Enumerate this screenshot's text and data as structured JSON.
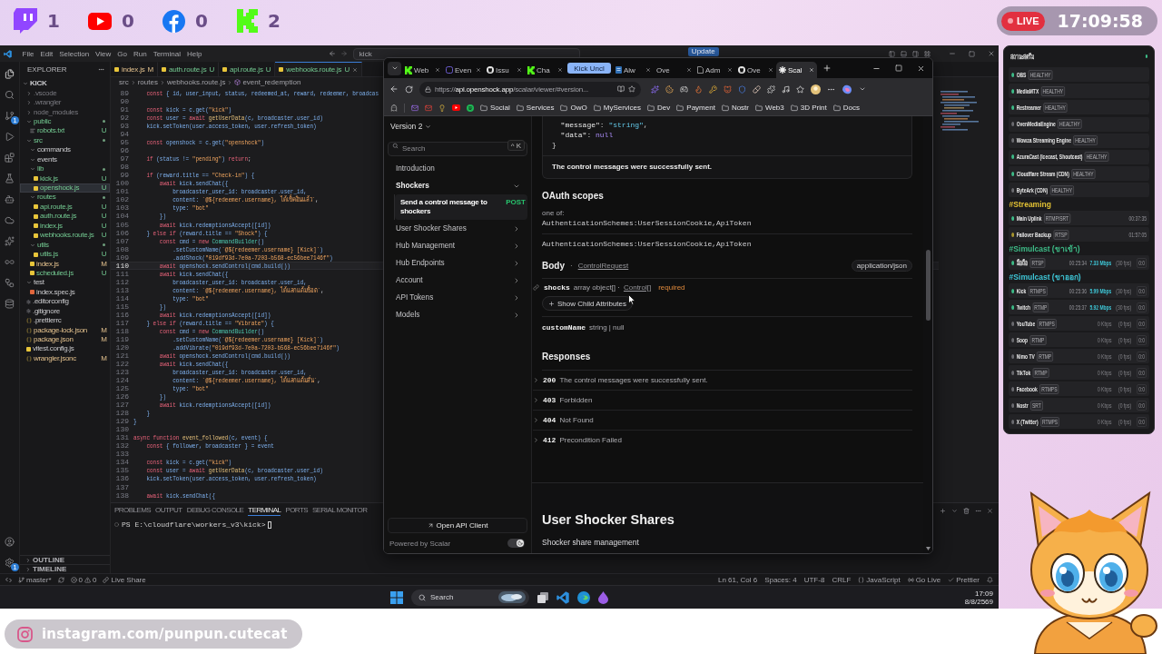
{
  "overlay": {
    "socials": [
      {
        "kind": "bubble",
        "count": "1"
      },
      {
        "kind": "play",
        "count": "0"
      },
      {
        "kind": "f-circle",
        "count": "0"
      },
      {
        "kind": "k-block",
        "count": "2"
      }
    ],
    "live": "LIVE",
    "clock": "17:09:58",
    "instagram": "instagram.com/punpun.cutecat"
  },
  "vscode": {
    "menu": [
      "File",
      "Edit",
      "Selection",
      "View",
      "Go",
      "Run",
      "Terminal",
      "Help"
    ],
    "command_center": "kick",
    "update": "Update",
    "scm_badge": "1",
    "settings_badge": "1",
    "explorer": {
      "title": "EXPLORER",
      "tree": [
        {
          "label": "KICK",
          "kind": "root",
          "expanded": true,
          "selected": false,
          "children": [
            {
              "label": ".vscode",
              "kind": "folder",
              "expanded": false,
              "ignored": true,
              "changed": false,
              "selected": false
            },
            {
              "label": ".wrangler",
              "kind": "folder",
              "expanded": false,
              "ignored": true,
              "changed": false,
              "selected": false
            },
            {
              "label": "node_modules",
              "kind": "folder",
              "expanded": false,
              "ignored": true,
              "changed": false,
              "selected": false
            },
            {
              "label": "public",
              "kind": "folder",
              "expanded": true,
              "ignored": false,
              "changed": true,
              "selected": false,
              "children": [
                {
                  "label": "robots.txt",
                  "kind": "text",
                  "status": "U",
                  "selected": false
                }
              ]
            },
            {
              "label": "src",
              "kind": "folder",
              "expanded": true,
              "ignored": false,
              "changed": true,
              "selected": false,
              "children": [
                {
                  "label": "commands",
                  "kind": "folder",
                  "expanded": true,
                  "ignored": false,
                  "changed": false,
                  "selected": false
                },
                {
                  "label": "events",
                  "kind": "folder",
                  "expanded": true,
                  "ignored": false,
                  "changed": false,
                  "selected": false
                },
                {
                  "label": "lib",
                  "kind": "folder",
                  "expanded": true,
                  "ignored": false,
                  "changed": true,
                  "selected": false,
                  "children": [
                    {
                      "label": "kick.js",
                      "kind": "js",
                      "status": "U",
                      "selected": false
                    },
                    {
                      "label": "openshock.js",
                      "kind": "js",
                      "status": "U",
                      "selected": true
                    }
                  ]
                },
                {
                  "label": "routes",
                  "kind": "folder",
                  "expanded": true,
                  "ignored": false,
                  "changed": true,
                  "selected": false,
                  "children": [
                    {
                      "label": "api.route.js",
                      "kind": "js",
                      "status": "U",
                      "selected": false
                    },
                    {
                      "label": "auth.route.js",
                      "kind": "js",
                      "status": "U",
                      "selected": false
                    },
                    {
                      "label": "index.js",
                      "kind": "js",
                      "status": "U",
                      "selected": false
                    },
                    {
                      "label": "webhooks.route.js",
                      "kind": "js",
                      "status": "U",
                      "selected": false
                    }
                  ]
                },
                {
                  "label": "utils",
                  "kind": "folder",
                  "expanded": true,
                  "ignored": false,
                  "changed": true,
                  "selected": false,
                  "children": [
                    {
                      "label": "utils.js",
                      "kind": "js",
                      "status": "U",
                      "selected": false
                    }
                  ]
                },
                {
                  "label": "index.js",
                  "kind": "js",
                  "status": "M",
                  "selected": false
                },
                {
                  "label": "scheduled.js",
                  "kind": "js",
                  "status": "U",
                  "selected": false
                }
              ]
            },
            {
              "label": "test",
              "kind": "folder",
              "expanded": true,
              "ignored": false,
              "changed": false,
              "selected": false,
              "children": [
                {
                  "label": "index.spec.js",
                  "kind": "test",
                  "selected": false
                }
              ]
            },
            {
              "label": ".editorconfig",
              "kind": "config",
              "selected": false
            },
            {
              "label": ".gitignore",
              "kind": "config",
              "selected": false
            },
            {
              "label": ".prettierrc",
              "kind": "json",
              "selected": false
            },
            {
              "label": "package-lock.json",
              "kind": "json",
              "status": "M",
              "selected": false
            },
            {
              "label": "package.json",
              "kind": "json",
              "status": "M",
              "selected": false
            },
            {
              "label": "vitest.config.js",
              "kind": "js",
              "selected": false
            },
            {
              "label": "wrangler.jsonc",
              "kind": "json",
              "status": "M",
              "selected": false
            }
          ]
        }
      ],
      "sections": [
        {
          "label": "OUTLINE",
          "expanded": false
        },
        {
          "label": "TIMELINE",
          "expanded": false
        }
      ]
    },
    "tabs": [
      {
        "label": "index.js",
        "status": "M",
        "selected": false
      },
      {
        "label": "auth.route.js",
        "status": "U",
        "selected": false
      },
      {
        "label": "api.route.js",
        "status": "U",
        "selected": false
      },
      {
        "label": "webhooks.route.js",
        "status": "U",
        "selected": true
      }
    ],
    "breadcrumb": [
      "src",
      "routes",
      "webhooks.route.js",
      "event_redemption"
    ],
    "code": [
      {
        "number": "89",
        "current": false,
        "tokens": [
          {
            "kind": "kw",
            "text": "    const "
          },
          {
            "kind": "id",
            "text": "{ id, user_input, status, redeemed_at, reward, redeemer, broadcas"
          }
        ]
      },
      {
        "number": "90",
        "current": false
      },
      {
        "number": "91",
        "current": false,
        "tokens": [
          {
            "kind": "kw",
            "text": "    const "
          },
          {
            "kind": "id",
            "text": "kick = c.get("
          },
          {
            "kind": "str",
            "text": "\"kick\""
          },
          {
            "kind": "id",
            "text": ")"
          }
        ]
      },
      {
        "number": "92",
        "current": false,
        "tokens": [
          {
            "kind": "kw",
            "text": "    const "
          },
          {
            "kind": "id",
            "text": "user = "
          },
          {
            "kind": "kw",
            "text": "await "
          },
          {
            "kind": "fn",
            "text": "getUserData"
          },
          {
            "kind": "id",
            "text": "(c, broadcaster.user_id)"
          }
        ]
      },
      {
        "number": "93",
        "current": false,
        "tokens": [
          {
            "kind": "id",
            "text": "    kick.setToken(user.access_token, user.refresh_token)"
          }
        ]
      },
      {
        "number": "94",
        "current": false
      },
      {
        "number": "95",
        "current": false,
        "tokens": [
          {
            "kind": "kw",
            "text": "    const "
          },
          {
            "kind": "id",
            "text": "openshock = c.get("
          },
          {
            "kind": "str",
            "text": "\"openshock\""
          },
          {
            "kind": "id",
            "text": ")"
          }
        ]
      },
      {
        "number": "96",
        "current": false
      },
      {
        "number": "97",
        "current": false,
        "tokens": [
          {
            "kind": "kw",
            "text": "    if "
          },
          {
            "kind": "id",
            "text": "(status != "
          },
          {
            "kind": "str",
            "text": "\"pending\""
          },
          {
            "kind": "id",
            "text": ") "
          },
          {
            "kind": "kw",
            "text": "return"
          },
          {
            "kind": "pl",
            "text": ";"
          }
        ]
      },
      {
        "number": "98",
        "current": false
      },
      {
        "number": "99",
        "current": false,
        "tokens": [
          {
            "kind": "kw",
            "text": "    if "
          },
          {
            "kind": "id",
            "text": "(reward.title == "
          },
          {
            "kind": "str",
            "text": "\"Check-in\""
          },
          {
            "kind": "id",
            "text": ") {"
          }
        ]
      },
      {
        "number": "100",
        "current": false,
        "tokens": [
          {
            "kind": "kw",
            "text": "        await "
          },
          {
            "kind": "id",
            "text": "kick.sendChat({"
          }
        ]
      },
      {
        "number": "101",
        "current": false,
        "tokens": [
          {
            "kind": "id",
            "text": "            broadcaster_user_id: broadcaster.user_id,"
          }
        ]
      },
      {
        "number": "102",
        "current": false,
        "tokens": [
          {
            "kind": "id",
            "text": "            content: "
          },
          {
            "kind": "str",
            "text": "`@${redeemer.username}, ได้เช็คอินแล้ว`"
          },
          {
            "kind": "pl",
            "text": ","
          }
        ]
      },
      {
        "number": "103",
        "current": false,
        "tokens": [
          {
            "kind": "id",
            "text": "            type: "
          },
          {
            "kind": "str",
            "text": "\"bot\""
          }
        ]
      },
      {
        "number": "104",
        "current": false,
        "tokens": [
          {
            "kind": "id",
            "text": "        })"
          }
        ]
      },
      {
        "number": "105",
        "current": false,
        "tokens": [
          {
            "kind": "kw",
            "text": "        await "
          },
          {
            "kind": "id",
            "text": "kick.redemptionsAccept([id])"
          }
        ]
      },
      {
        "number": "106",
        "current": false,
        "tokens": [
          {
            "kind": "id",
            "text": "    } "
          },
          {
            "kind": "kw",
            "text": "else if "
          },
          {
            "kind": "id",
            "text": "(reward.title == "
          },
          {
            "kind": "str",
            "text": "\"Shock\""
          },
          {
            "kind": "id",
            "text": ") {"
          }
        ]
      },
      {
        "number": "107",
        "current": false,
        "tokens": [
          {
            "kind": "kw",
            "text": "        const "
          },
          {
            "kind": "id",
            "text": "cmd = "
          },
          {
            "kind": "kw",
            "text": "new "
          },
          {
            "kind": "cls",
            "text": "CommandBuilder"
          },
          {
            "kind": "id",
            "text": "()"
          }
        ]
      },
      {
        "number": "108",
        "current": false,
        "tokens": [
          {
            "kind": "id",
            "text": "            .setCustomName("
          },
          {
            "kind": "str",
            "text": "`@${redeemer.username} [Kick]`"
          },
          {
            "kind": "id",
            "text": ")"
          }
        ]
      },
      {
        "number": "109",
        "current": false,
        "tokens": [
          {
            "kind": "id",
            "text": "            .addShock("
          },
          {
            "kind": "str",
            "text": "\"019df93d-7e0a-7203-b568-ec56bee7146f\""
          },
          {
            "kind": "id",
            "text": ")"
          }
        ]
      },
      {
        "number": "110",
        "current": true,
        "tokens": [
          {
            "kind": "kw",
            "text": "        await "
          },
          {
            "kind": "id",
            "text": "openshock.sendControl(cmd.build())"
          }
        ]
      },
      {
        "number": "111",
        "current": false,
        "tokens": [
          {
            "kind": "kw",
            "text": "        await "
          },
          {
            "kind": "id",
            "text": "kick.sendChat({"
          }
        ]
      },
      {
        "number": "112",
        "current": false,
        "tokens": [
          {
            "kind": "id",
            "text": "            broadcaster_user_id: broadcaster.user_id,"
          }
        ]
      },
      {
        "number": "113",
        "current": false,
        "tokens": [
          {
            "kind": "id",
            "text": "            content: "
          },
          {
            "kind": "str",
            "text": "`@${redeemer.username}, ได้แลกแต้มช็อต`"
          },
          {
            "kind": "pl",
            "text": ","
          }
        ]
      },
      {
        "number": "114",
        "current": false,
        "tokens": [
          {
            "kind": "id",
            "text": "            type: "
          },
          {
            "kind": "str",
            "text": "\"bot\""
          }
        ]
      },
      {
        "number": "115",
        "current": false,
        "tokens": [
          {
            "kind": "id",
            "text": "        })"
          }
        ]
      },
      {
        "number": "116",
        "current": false,
        "tokens": [
          {
            "kind": "kw",
            "text": "        await "
          },
          {
            "kind": "id",
            "text": "kick.redemptionsAccept([id])"
          }
        ]
      },
      {
        "number": "117",
        "current": false,
        "tokens": [
          {
            "kind": "id",
            "text": "    } "
          },
          {
            "kind": "kw",
            "text": "else if "
          },
          {
            "kind": "id",
            "text": "(reward.title == "
          },
          {
            "kind": "str",
            "text": "\"Vibrate\""
          },
          {
            "kind": "id",
            "text": ") {"
          }
        ]
      },
      {
        "number": "118",
        "current": false,
        "tokens": [
          {
            "kind": "kw",
            "text": "        const "
          },
          {
            "kind": "id",
            "text": "cmd = "
          },
          {
            "kind": "kw",
            "text": "new "
          },
          {
            "kind": "cls",
            "text": "CommandBuilder"
          },
          {
            "kind": "id",
            "text": "()"
          }
        ]
      },
      {
        "number": "119",
        "current": false,
        "tokens": [
          {
            "kind": "id",
            "text": "            .setCustomName("
          },
          {
            "kind": "str",
            "text": "`@${redeemer.username} [Kick]`"
          },
          {
            "kind": "id",
            "text": ")"
          }
        ]
      },
      {
        "number": "120",
        "current": false,
        "tokens": [
          {
            "kind": "id",
            "text": "            .addVibrate("
          },
          {
            "kind": "str",
            "text": "\"019df93d-7e0a-7203-b568-ec56bee7146f\""
          },
          {
            "kind": "id",
            "text": ")"
          }
        ]
      },
      {
        "number": "121",
        "current": false,
        "tokens": [
          {
            "kind": "kw",
            "text": "        await "
          },
          {
            "kind": "id",
            "text": "openshock.sendControl(cmd.build())"
          }
        ]
      },
      {
        "number": "122",
        "current": false,
        "tokens": [
          {
            "kind": "kw",
            "text": "        await "
          },
          {
            "kind": "id",
            "text": "kick.sendChat({"
          }
        ]
      },
      {
        "number": "123",
        "current": false,
        "tokens": [
          {
            "kind": "id",
            "text": "            broadcaster_user_id: broadcaster.user_id,"
          }
        ]
      },
      {
        "number": "124",
        "current": false,
        "tokens": [
          {
            "kind": "id",
            "text": "            content: "
          },
          {
            "kind": "str",
            "text": "`@${redeemer.username}, ได้แลกแต้มสั่น`"
          },
          {
            "kind": "pl",
            "text": ","
          }
        ]
      },
      {
        "number": "125",
        "current": false,
        "tokens": [
          {
            "kind": "id",
            "text": "            type: "
          },
          {
            "kind": "str",
            "text": "\"bot\""
          }
        ]
      },
      {
        "number": "126",
        "current": false,
        "tokens": [
          {
            "kind": "id",
            "text": "        })"
          }
        ]
      },
      {
        "number": "127",
        "current": false,
        "tokens": [
          {
            "kind": "kw",
            "text": "        await "
          },
          {
            "kind": "id",
            "text": "kick.redemptionsAccept([id])"
          }
        ]
      },
      {
        "number": "128",
        "current": false,
        "tokens": [
          {
            "kind": "id",
            "text": "    }"
          }
        ]
      },
      {
        "number": "129",
        "current": false,
        "tokens": [
          {
            "kind": "id",
            "text": "}"
          }
        ]
      },
      {
        "number": "130",
        "current": false
      },
      {
        "number": "131",
        "current": false,
        "tokens": [
          {
            "kind": "kw",
            "text": "async function "
          },
          {
            "kind": "fn",
            "text": "event_followed"
          },
          {
            "kind": "id",
            "text": "(c, event) {"
          }
        ]
      },
      {
        "number": "132",
        "current": false,
        "tokens": [
          {
            "kind": "kw",
            "text": "    const "
          },
          {
            "kind": "id",
            "text": "{ follower, broadcaster } = event"
          }
        ]
      },
      {
        "number": "133",
        "current": false
      },
      {
        "number": "134",
        "current": false,
        "tokens": [
          {
            "kind": "kw",
            "text": "    const "
          },
          {
            "kind": "id",
            "text": "kick = c.get("
          },
          {
            "kind": "str",
            "text": "\"kick\""
          },
          {
            "kind": "id",
            "text": ")"
          }
        ]
      },
      {
        "number": "135",
        "current": false,
        "tokens": [
          {
            "kind": "kw",
            "text": "    const "
          },
          {
            "kind": "id",
            "text": "user = "
          },
          {
            "kind": "kw",
            "text": "await "
          },
          {
            "kind": "fn",
            "text": "getUserData"
          },
          {
            "kind": "id",
            "text": "(c, broadcaster.user_id)"
          }
        ]
      },
      {
        "number": "136",
        "current": false,
        "tokens": [
          {
            "kind": "id",
            "text": "    kick.setToken(user.access_token, user.refresh_token)"
          }
        ]
      },
      {
        "number": "137",
        "current": false
      },
      {
        "number": "138",
        "current": false,
        "tokens": [
          {
            "kind": "kw",
            "text": "    await "
          },
          {
            "kind": "id",
            "text": "kick.sendChat({"
          }
        ]
      }
    ],
    "panel": {
      "tabs": [
        {
          "label": "PROBLEMS",
          "selected": false
        },
        {
          "label": "OUTPUT",
          "selected": false
        },
        {
          "label": "DEBUG CONSOLE",
          "selected": false
        },
        {
          "label": "TERMINAL",
          "selected": true
        },
        {
          "label": "PORTS",
          "selected": false
        },
        {
          "label": "SERIAL MONITOR",
          "selected": false
        }
      ],
      "prompt": "PS E:\\cloudflare\\workers_v3\\kick>"
    },
    "status_bar": {
      "branch": "master*",
      "errors": "0",
      "warnings": "0",
      "live_share": "Live Share",
      "items": [
        {
          "label": "Ln 61, Col 6",
          "kind": "plain"
        },
        {
          "label": "Spaces: 4",
          "kind": "plain"
        },
        {
          "label": "UTF-8",
          "kind": "plain"
        },
        {
          "label": "CRLF",
          "kind": "plain"
        },
        {
          "label": "JavaScript",
          "kind": "language"
        },
        {
          "label": "Go Live",
          "kind": "live"
        },
        {
          "label": "Prettier",
          "kind": "formatter"
        }
      ]
    }
  },
  "taskbar": {
    "search": "Search",
    "time": "17:09",
    "date": "8/8/2569"
  },
  "browser": {
    "tabs": [
      {
        "label": "Web",
        "kind": "k",
        "selected": false
      },
      {
        "label": "Even",
        "kind": "app",
        "selected": false
      },
      {
        "label": "Issu",
        "kind": "cat",
        "selected": false
      },
      {
        "label": "Cha",
        "kind": "k",
        "selected": false
      },
      {
        "label": "Kick Uncl",
        "kind": "group"
      },
      {
        "label": "Alw",
        "kind": "doc",
        "selected": false
      },
      {
        "label": "Ove",
        "kind": "blank",
        "selected": false
      },
      {
        "label": "Adm",
        "kind": "page",
        "selected": false
      },
      {
        "label": "Ove",
        "kind": "cat",
        "selected": false
      },
      {
        "label": "Scal",
        "kind": "asterisk",
        "selected": true
      }
    ],
    "url": {
      "scheme": "https://",
      "host": "api.openshock.app",
      "path": "/scalar/viewer/#version..."
    },
    "bookmarks": [
      "Social",
      "Services",
      "OwO",
      "MyServices",
      "Dev",
      "Payment",
      "Nostr",
      "Web3",
      "3D Print",
      "Docs"
    ]
  },
  "docs": {
    "version": "Version 2",
    "search": {
      "placeholder": "Search",
      "shortcut": "^ K"
    },
    "nav": [
      {
        "label": "Introduction",
        "kind": "page",
        "selected": false
      },
      {
        "label": "Shockers",
        "kind": "group",
        "expanded": true,
        "selected": false,
        "children": [
          {
            "label": "Send a control message to shockers",
            "method": "POST",
            "selected": true
          }
        ]
      },
      {
        "label": "User Shocker Shares",
        "kind": "group",
        "expanded": false,
        "selected": false
      },
      {
        "label": "Hub Management",
        "kind": "group",
        "expanded": false,
        "selected": false
      },
      {
        "label": "Hub Endpoints",
        "kind": "group",
        "expanded": false,
        "selected": false
      },
      {
        "label": "Account",
        "kind": "group",
        "expanded": false,
        "selected": false
      },
      {
        "label": "API Tokens",
        "kind": "group",
        "expanded": false,
        "selected": false
      },
      {
        "label": "Models",
        "kind": "group",
        "expanded": false,
        "selected": false
      }
    ],
    "open_client": "Open API Client",
    "powered_by": "Powered by Scalar",
    "dark_mode": true,
    "example": {
      "lines": [
        {
          "tokens": [
            {
              "kind": "key",
              "text": "  \"message\""
            },
            {
              "kind": "punct",
              "text": ": "
            },
            {
              "kind": "string",
              "text": "\"string\""
            },
            {
              "kind": "punct",
              "text": ","
            }
          ]
        },
        {
          "tokens": [
            {
              "kind": "key",
              "text": "  \"data\""
            },
            {
              "kind": "punct",
              "text": ": "
            },
            {
              "kind": "null",
              "text": "null"
            }
          ]
        },
        {
          "tokens": [
            {
              "kind": "punct",
              "text": "}"
            }
          ]
        }
      ],
      "description": "The control messages were successfully sent."
    },
    "oauth": {
      "title": "OAuth scopes",
      "one_of": "one of:",
      "scopes": [
        "AuthenticationSchemes:UserSessionCookie,ApiToken",
        "AuthenticationSchemes:UserSessionCookie,ApiToken"
      ]
    },
    "body": {
      "title": "Body",
      "separator": "·",
      "schema": "ControlRequest",
      "content_type": "application/json",
      "fields": [
        {
          "name": "shocks",
          "type": "array object[] ·",
          "ref": "Control[]",
          "required": "required",
          "expand_label": "Show Child Attributes"
        },
        {
          "name": "customName",
          "type": "string | null"
        }
      ]
    },
    "responses": {
      "title": "Responses",
      "items": [
        {
          "code": "200",
          "text": "The control messages were successfully sent.",
          "expanded": false
        },
        {
          "code": "403",
          "text": "Forbidden",
          "expanded": false
        },
        {
          "code": "404",
          "text": "Not Found",
          "expanded": false
        },
        {
          "code": "412",
          "text": "Precondition Failed",
          "expanded": false
        }
      ]
    },
    "next_section": {
      "title": "User Shocker Shares",
      "description": "Shocker share management"
    }
  },
  "stream_status": {
    "title": "สถานะสตรีม",
    "online": true,
    "services": [
      {
        "name": "OBS",
        "badge": "HEALTHY",
        "color": "#3dbb87"
      },
      {
        "name": "MediaMTX",
        "badge": "HEALTHY",
        "color": "#3dbb87"
      },
      {
        "name": "Restreamer",
        "badge": "HEALTHY",
        "color": "#3dbb87"
      },
      {
        "name": "OvenMediaEngine",
        "badge": "HEALTHY",
        "color": "#6b6b70"
      },
      {
        "name": "Wowza Streaming Engine",
        "badge": "HEALTHY",
        "color": "#6b6b70"
      },
      {
        "name": "AzuraCast (Icecast, Shoutcast)",
        "badge": "HEALTHY",
        "color": "#3dbb87"
      },
      {
        "name": "Cloudflare Stream (CDN)",
        "badge": "HEALTHY",
        "color": "#3dbb87"
      },
      {
        "name": "ByteArk (CDN)",
        "badge": "HEALTHY",
        "color": "#6b6b70"
      }
    ],
    "groups": [
      {
        "title": "#Streaming",
        "color": "#e3c234",
        "rows": [
          {
            "name": "Main Uplink",
            "protocol": "RTMP/SRT",
            "uptime": "00:37:35",
            "color": "#3dbb87"
          },
          {
            "name": "Failover Backup",
            "protocol": "RTSP",
            "uptime": "01:57:05",
            "color": "#a8952e"
          }
        ]
      },
      {
        "title": "#Simulcast (ขาเข้า)",
        "color": "#3dbb87",
        "rows": [
          {
            "name": "มือถือ",
            "protocol": "RTSP",
            "uptime": "00:25:34",
            "bitrate": "7.33 Mbps",
            "fps": "(30 fps)",
            "ratio": "0:0",
            "color": "#3dbb87",
            "active": true
          }
        ]
      },
      {
        "title": "#Simulcast (ขาออก)",
        "color": "#3ec6d6",
        "rows": [
          {
            "name": "Kick",
            "protocol": "RTMPS",
            "uptime": "00:25:36",
            "bitrate": "5.99 Mbps",
            "fps": "(30 fps)",
            "ratio": "0:0",
            "color": "#3dbb87",
            "active": true
          },
          {
            "name": "Twitch",
            "protocol": "RTMP",
            "uptime": "00:25:37",
            "bitrate": "5.92 Mbps",
            "fps": "(30 fps)",
            "ratio": "0:0",
            "color": "#3dbb87",
            "active": true
          },
          {
            "name": "YouTube",
            "protocol": "RTMPS",
            "bitrate": "0 Kbps",
            "fps": "(0 fps)",
            "ratio": "0:0",
            "color": "#6b6b70",
            "active": false
          },
          {
            "name": "Soop",
            "protocol": "RTMP",
            "bitrate": "0 Kbps",
            "fps": "(0 fps)",
            "ratio": "0:0",
            "color": "#6b6b70",
            "active": false
          },
          {
            "name": "Nimo TV",
            "protocol": "RTMP",
            "bitrate": "0 Kbps",
            "fps": "(0 fps)",
            "ratio": "0:0",
            "color": "#6b6b70",
            "active": false
          },
          {
            "name": "TikTok",
            "protocol": "RTMP",
            "bitrate": "0 Kbps",
            "fps": "(0 fps)",
            "ratio": "0:0",
            "color": "#6b6b70",
            "active": false
          },
          {
            "name": "Facebook",
            "protocol": "RTMPS",
            "bitrate": "0 Kbps",
            "fps": "(0 fps)",
            "ratio": "0:0",
            "color": "#6b6b70",
            "active": false
          },
          {
            "name": "Nostr",
            "protocol": "SRT",
            "bitrate": "0 Kbps",
            "fps": "(0 fps)",
            "ratio": "0:0",
            "color": "#6b6b70",
            "active": false
          },
          {
            "name": "X (Twitter)",
            "protocol": "RTMPS",
            "bitrate": "0 Kbps",
            "fps": "(0 fps)",
            "ratio": "0:0",
            "color": "#6b6b70",
            "active": false
          }
        ]
      }
    ]
  }
}
